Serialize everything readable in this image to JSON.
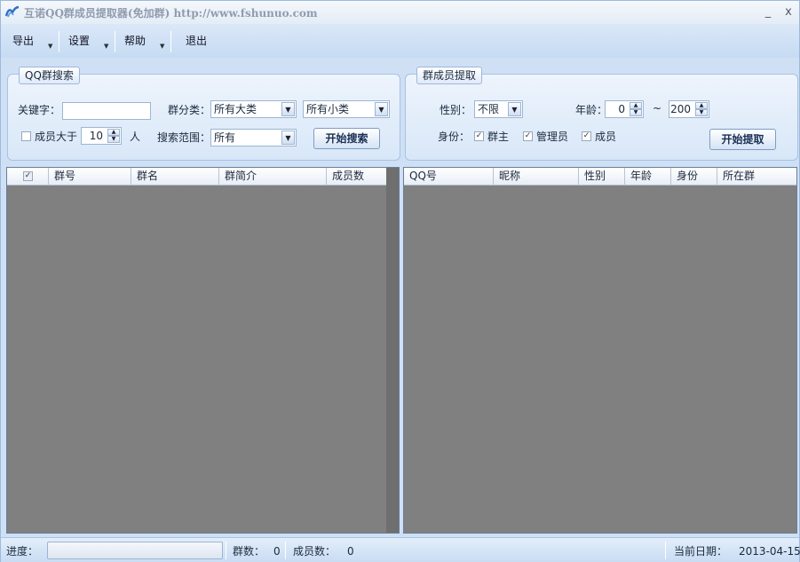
{
  "window": {
    "title": "互诺QQ群成员提取器(免加群) http://www.fshunuo.com",
    "minimize_label": "_",
    "close_label": "x"
  },
  "menu": {
    "export": "导出",
    "settings": "设置",
    "help": "帮助",
    "exit": "退出"
  },
  "group_search": {
    "legend": "QQ群搜索",
    "keyword_label": "关键字：",
    "keyword_value": "",
    "category_label": "群分类：",
    "category_main": "所有大类",
    "category_sub": "所有小类",
    "members_more_label": "成员大于",
    "members_more_checked": false,
    "members_more_value": "10",
    "people_unit": "人",
    "scope_label": "搜索范围：",
    "scope_value": "所有",
    "search_button": "开始搜索"
  },
  "member_extract": {
    "legend": "群成员提取",
    "gender_label": "性别：",
    "gender_value": "不限",
    "age_label": "年龄：",
    "age_min": "0",
    "age_sep": "~",
    "age_max": "200",
    "role_label": "身份：",
    "role_owner": "群主",
    "role_admin": "管理员",
    "role_member": "成员",
    "role_owner_checked": true,
    "role_admin_checked": true,
    "role_member_checked": true,
    "extract_button": "开始提取"
  },
  "group_grid": {
    "columns": [
      "群号",
      "群名",
      "群简介",
      "成员数"
    ],
    "rows": []
  },
  "member_grid": {
    "columns": [
      "QQ号",
      "昵称",
      "性别",
      "年龄",
      "身份",
      "所在群"
    ],
    "rows": []
  },
  "status": {
    "progress_label": "进度：",
    "progress_value": 0,
    "group_count_label": "群数：",
    "group_count": "0",
    "member_count_label": "成员数：",
    "member_count": "0",
    "date_label": "当前日期：",
    "date": "2013-04-15"
  },
  "colors": {
    "window_bg": "#cfe0f5",
    "grid_bg": "#808080"
  }
}
